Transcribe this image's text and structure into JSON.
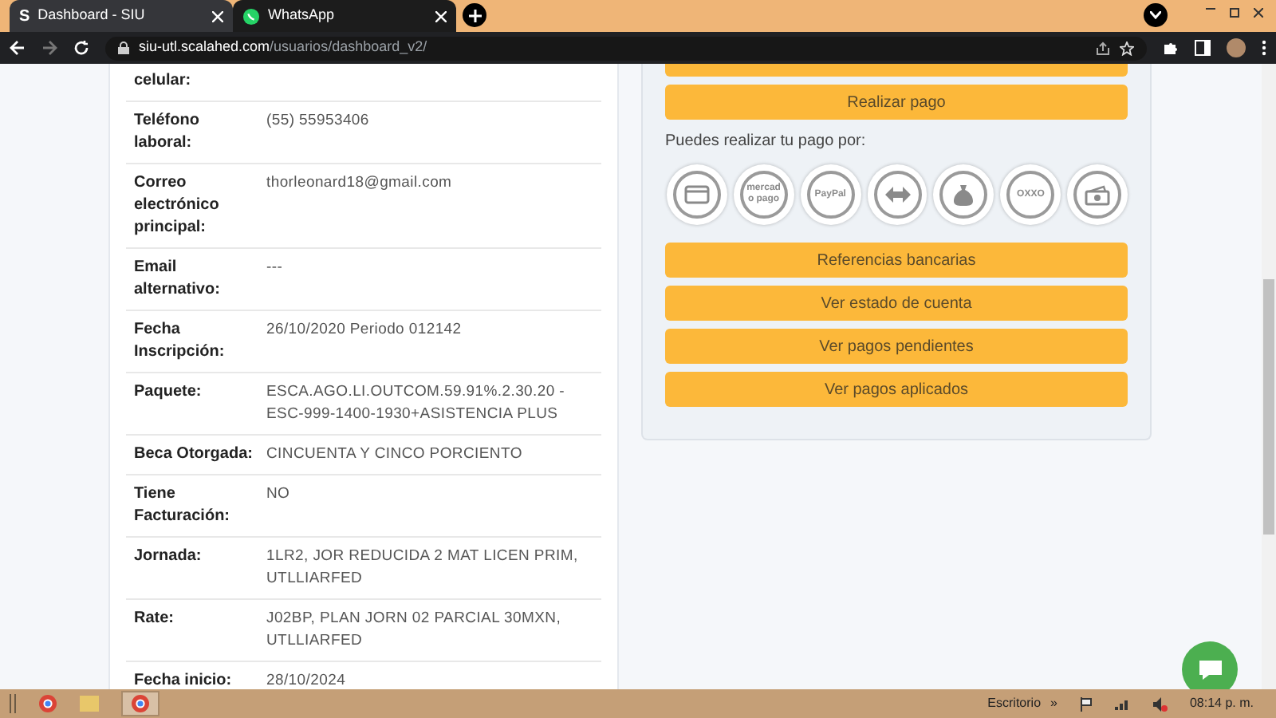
{
  "browser": {
    "tabs": [
      {
        "title": "Dashboard - SIU",
        "icon_letter": "S",
        "selected": true
      },
      {
        "title": "WhatsApp",
        "selected": false
      }
    ],
    "url_host": "siu-utl.scalahed.com",
    "url_path": "/usuarios/dashboard_v2/"
  },
  "profile": {
    "rows": [
      {
        "label": "celular:",
        "value": ""
      },
      {
        "label": "Teléfono laboral:",
        "value": "(55) 55953406"
      },
      {
        "label": "Correo electrónico principal:",
        "value": "thorleonard18@gmail.com"
      },
      {
        "label": "Email alternativo:",
        "value": "---"
      },
      {
        "label": "Fecha Inscripción:",
        "value": "26/10/2020 Periodo 012142"
      },
      {
        "label": "Paquete:",
        "value": "ESCA.AGO.LI.OUTCOM.59.91%.2.30.20 - ESC-999-1400-1930+ASISTENCIA PLUS"
      },
      {
        "label": "Beca Otorgada:",
        "value": "CINCUENTA Y CINCO PORCIENTO"
      },
      {
        "label": "Tiene Facturación:",
        "value": "NO"
      },
      {
        "label": "Jornada:",
        "value": "1LR2, JOR REDUCIDA 2 MAT LICEN PRIM, UTLLIARFED"
      },
      {
        "label": "Rate:",
        "value": "J02BP, PLAN JORN 02 PARCIAL 30MXN, UTLLIARFED"
      },
      {
        "label": "Fecha inicio:",
        "value": "28/10/2024"
      }
    ]
  },
  "payments": {
    "pay_button": "Realizar pago",
    "methods_label": "Puedes realizar tu pago por:",
    "methods": [
      {
        "kind": "card"
      },
      {
        "kind": "mercadopago",
        "text": "mercado pago"
      },
      {
        "kind": "paypal",
        "text": "PayPal"
      },
      {
        "kind": "transfer"
      },
      {
        "kind": "moneybag"
      },
      {
        "kind": "oxxo",
        "text": "OXXO"
      },
      {
        "kind": "cash"
      }
    ],
    "buttons": [
      "Referencias bancarias",
      "Ver estado de cuenta",
      "Ver pagos pendientes",
      "Ver pagos aplicados"
    ]
  },
  "taskbar": {
    "desktop_label": "Escritorio",
    "overflow": "»",
    "time": "08:14 p. m."
  }
}
